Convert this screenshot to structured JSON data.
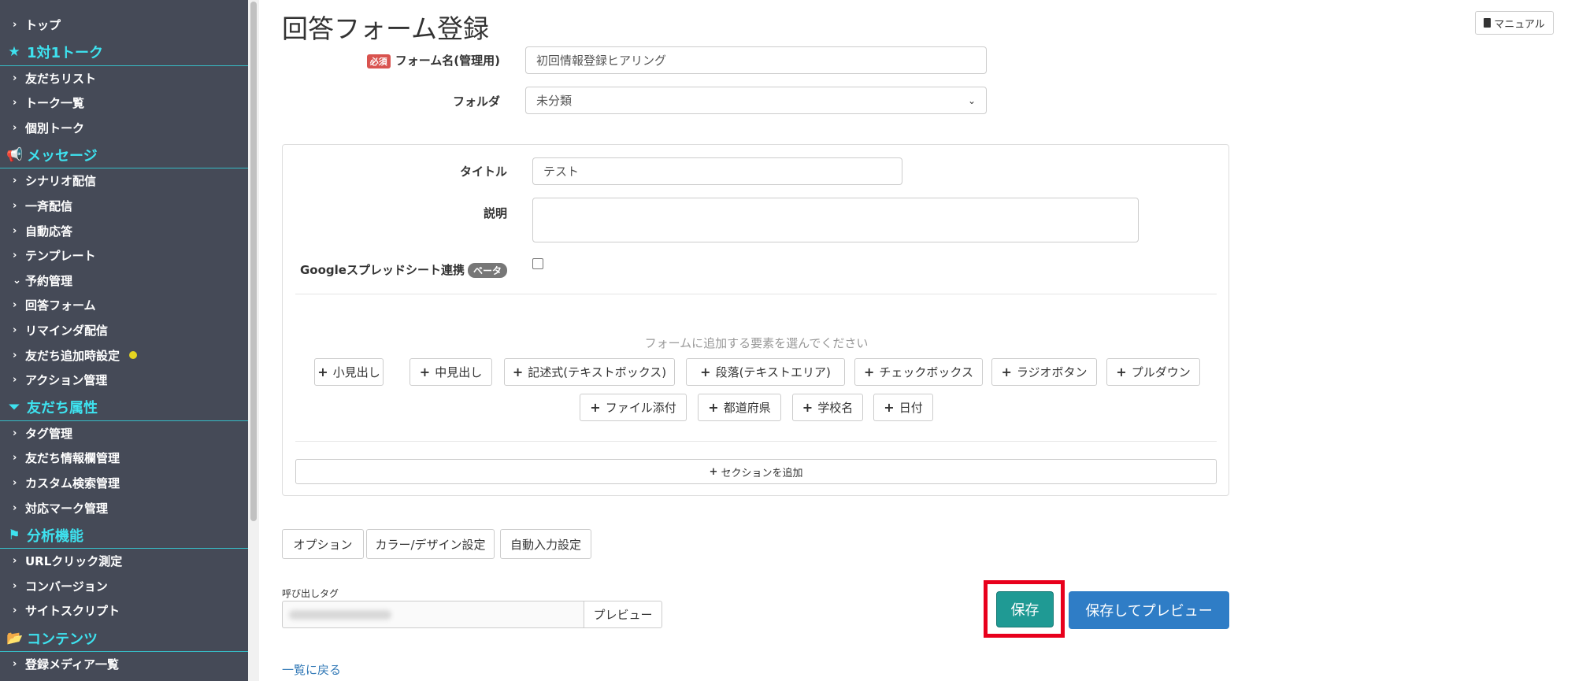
{
  "sidebar": {
    "items": [
      {
        "kind": "item",
        "label": "トップ",
        "chevron": "right"
      },
      {
        "kind": "section",
        "label": "1対1トーク",
        "icon": "star-icon"
      },
      {
        "kind": "item",
        "label": "友だちリスト",
        "chevron": "right"
      },
      {
        "kind": "item",
        "label": "トーク一覧",
        "chevron": "right"
      },
      {
        "kind": "item",
        "label": "個別トーク",
        "chevron": "right"
      },
      {
        "kind": "section",
        "label": "メッセージ",
        "icon": "megaphone-icon"
      },
      {
        "kind": "item",
        "label": "シナリオ配信",
        "chevron": "right"
      },
      {
        "kind": "item",
        "label": "一斉配信",
        "chevron": "right"
      },
      {
        "kind": "item",
        "label": "自動応答",
        "chevron": "right"
      },
      {
        "kind": "item",
        "label": "テンプレート",
        "chevron": "right"
      },
      {
        "kind": "item",
        "label": "予約管理",
        "chevron": "down"
      },
      {
        "kind": "item",
        "label": "回答フォーム",
        "chevron": "right"
      },
      {
        "kind": "item",
        "label": "リマインダ配信",
        "chevron": "right"
      },
      {
        "kind": "item",
        "label": "友だち追加時設定",
        "chevron": "right",
        "dot": true
      },
      {
        "kind": "item",
        "label": "アクション管理",
        "chevron": "right"
      },
      {
        "kind": "section",
        "label": "友だち属性",
        "icon": "filter-icon"
      },
      {
        "kind": "item",
        "label": "タグ管理",
        "chevron": "right"
      },
      {
        "kind": "item",
        "label": "友だち情報欄管理",
        "chevron": "right"
      },
      {
        "kind": "item",
        "label": "カスタム検索管理",
        "chevron": "right"
      },
      {
        "kind": "item",
        "label": "対応マーク管理",
        "chevron": "right"
      },
      {
        "kind": "section",
        "label": "分析機能",
        "icon": "flag-icon"
      },
      {
        "kind": "item",
        "label": "URLクリック測定",
        "chevron": "right"
      },
      {
        "kind": "item",
        "label": "コンバージョン",
        "chevron": "right"
      },
      {
        "kind": "item",
        "label": "サイトスクリプト",
        "chevron": "right"
      },
      {
        "kind": "section",
        "label": "コンテンツ",
        "icon": "folder-open-icon"
      },
      {
        "kind": "item",
        "label": "登録メディア一覧",
        "chevron": "right"
      }
    ],
    "dot_color": "#e5d420",
    "section_color": "#3ee2ef"
  },
  "header": {
    "title": "回答フォーム登録",
    "manual_label": "マニュアル"
  },
  "form": {
    "required_badge": "必須",
    "name_label": "フォーム名(管理用)",
    "name_value": "初回情報登録ヒアリング",
    "folder_label": "フォルダ",
    "folder_value": "未分類"
  },
  "panel": {
    "title_label": "タイトル",
    "title_value": "テスト",
    "description_label": "説明",
    "description_value": "",
    "sheets_label": "Googleスプレッドシート連携",
    "beta_badge": "ベータ",
    "sheets_checked": false,
    "add_hint": "フォームに追加する要素を選んでください",
    "element_buttons_row1": [
      "小見出し",
      "中見出し",
      "記述式(テキストボックス)",
      "段落(テキストエリア)",
      "チェックボックス",
      "ラジオボタン",
      "プルダウン"
    ],
    "element_buttons_row2": [
      "ファイル添付",
      "都道府県",
      "学校名",
      "日付"
    ],
    "add_section_label": "セクションを追加"
  },
  "options": {
    "buttons": [
      "オプション",
      "カラー/デザイン設定",
      "自動入力設定"
    ]
  },
  "callout": {
    "label": "呼び出しタグ",
    "preview_label": "プレビュー"
  },
  "actions": {
    "save_label": "保存",
    "save_preview_label": "保存してプレビュー",
    "highlight_color": "#e8001c"
  },
  "back_link": "一覧に戻る"
}
